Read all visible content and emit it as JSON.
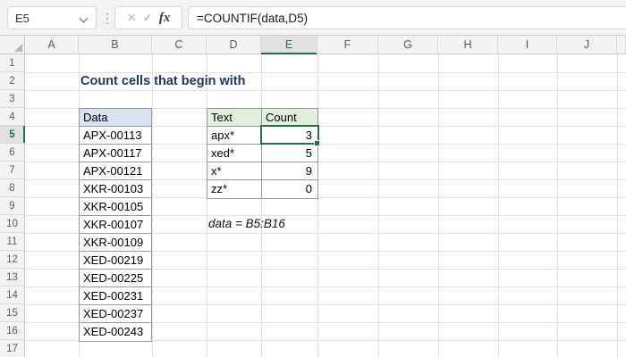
{
  "formula_bar": {
    "name_box_value": "E5",
    "formula": "=COUNTIF(data,D5)",
    "cancel_icon": "✕",
    "enter_icon": "✓",
    "fx_icon": "fx",
    "dots_icon": "⋮"
  },
  "grid": {
    "column_letters": [
      "A",
      "B",
      "C",
      "D",
      "E",
      "F",
      "G",
      "H",
      "I",
      "J"
    ],
    "row_numbers": [
      1,
      2,
      3,
      4,
      5,
      6,
      7,
      8,
      9,
      10,
      11,
      12,
      13,
      14,
      15,
      16,
      17
    ],
    "selection": {
      "cell": "E5",
      "column": "E",
      "row": 5
    }
  },
  "sheet": {
    "title": "Count cells that begin with",
    "note": "data = B5:B16",
    "data_table": {
      "header": "Data",
      "values": [
        "APX-00113",
        "APX-00117",
        "APX-00121",
        "XKR-00103",
        "XKR-00105",
        "XKR-00107",
        "XKR-00109",
        "XED-00219",
        "XED-00225",
        "XED-00231",
        "XED-00237",
        "XED-00243"
      ]
    },
    "criteria_table": {
      "text_header": "Text",
      "count_header": "Count",
      "rows": [
        {
          "text": "apx*",
          "count": 3
        },
        {
          "text": "xed*",
          "count": 5
        },
        {
          "text": "x*",
          "count": 9
        },
        {
          "text": "zz*",
          "count": 0
        }
      ]
    }
  },
  "colors": {
    "selection_green": "#217346",
    "data_header_fill": "#D9E1F2",
    "criteria_header_fill": "#E2EFDA",
    "title_color": "#1F3864"
  }
}
